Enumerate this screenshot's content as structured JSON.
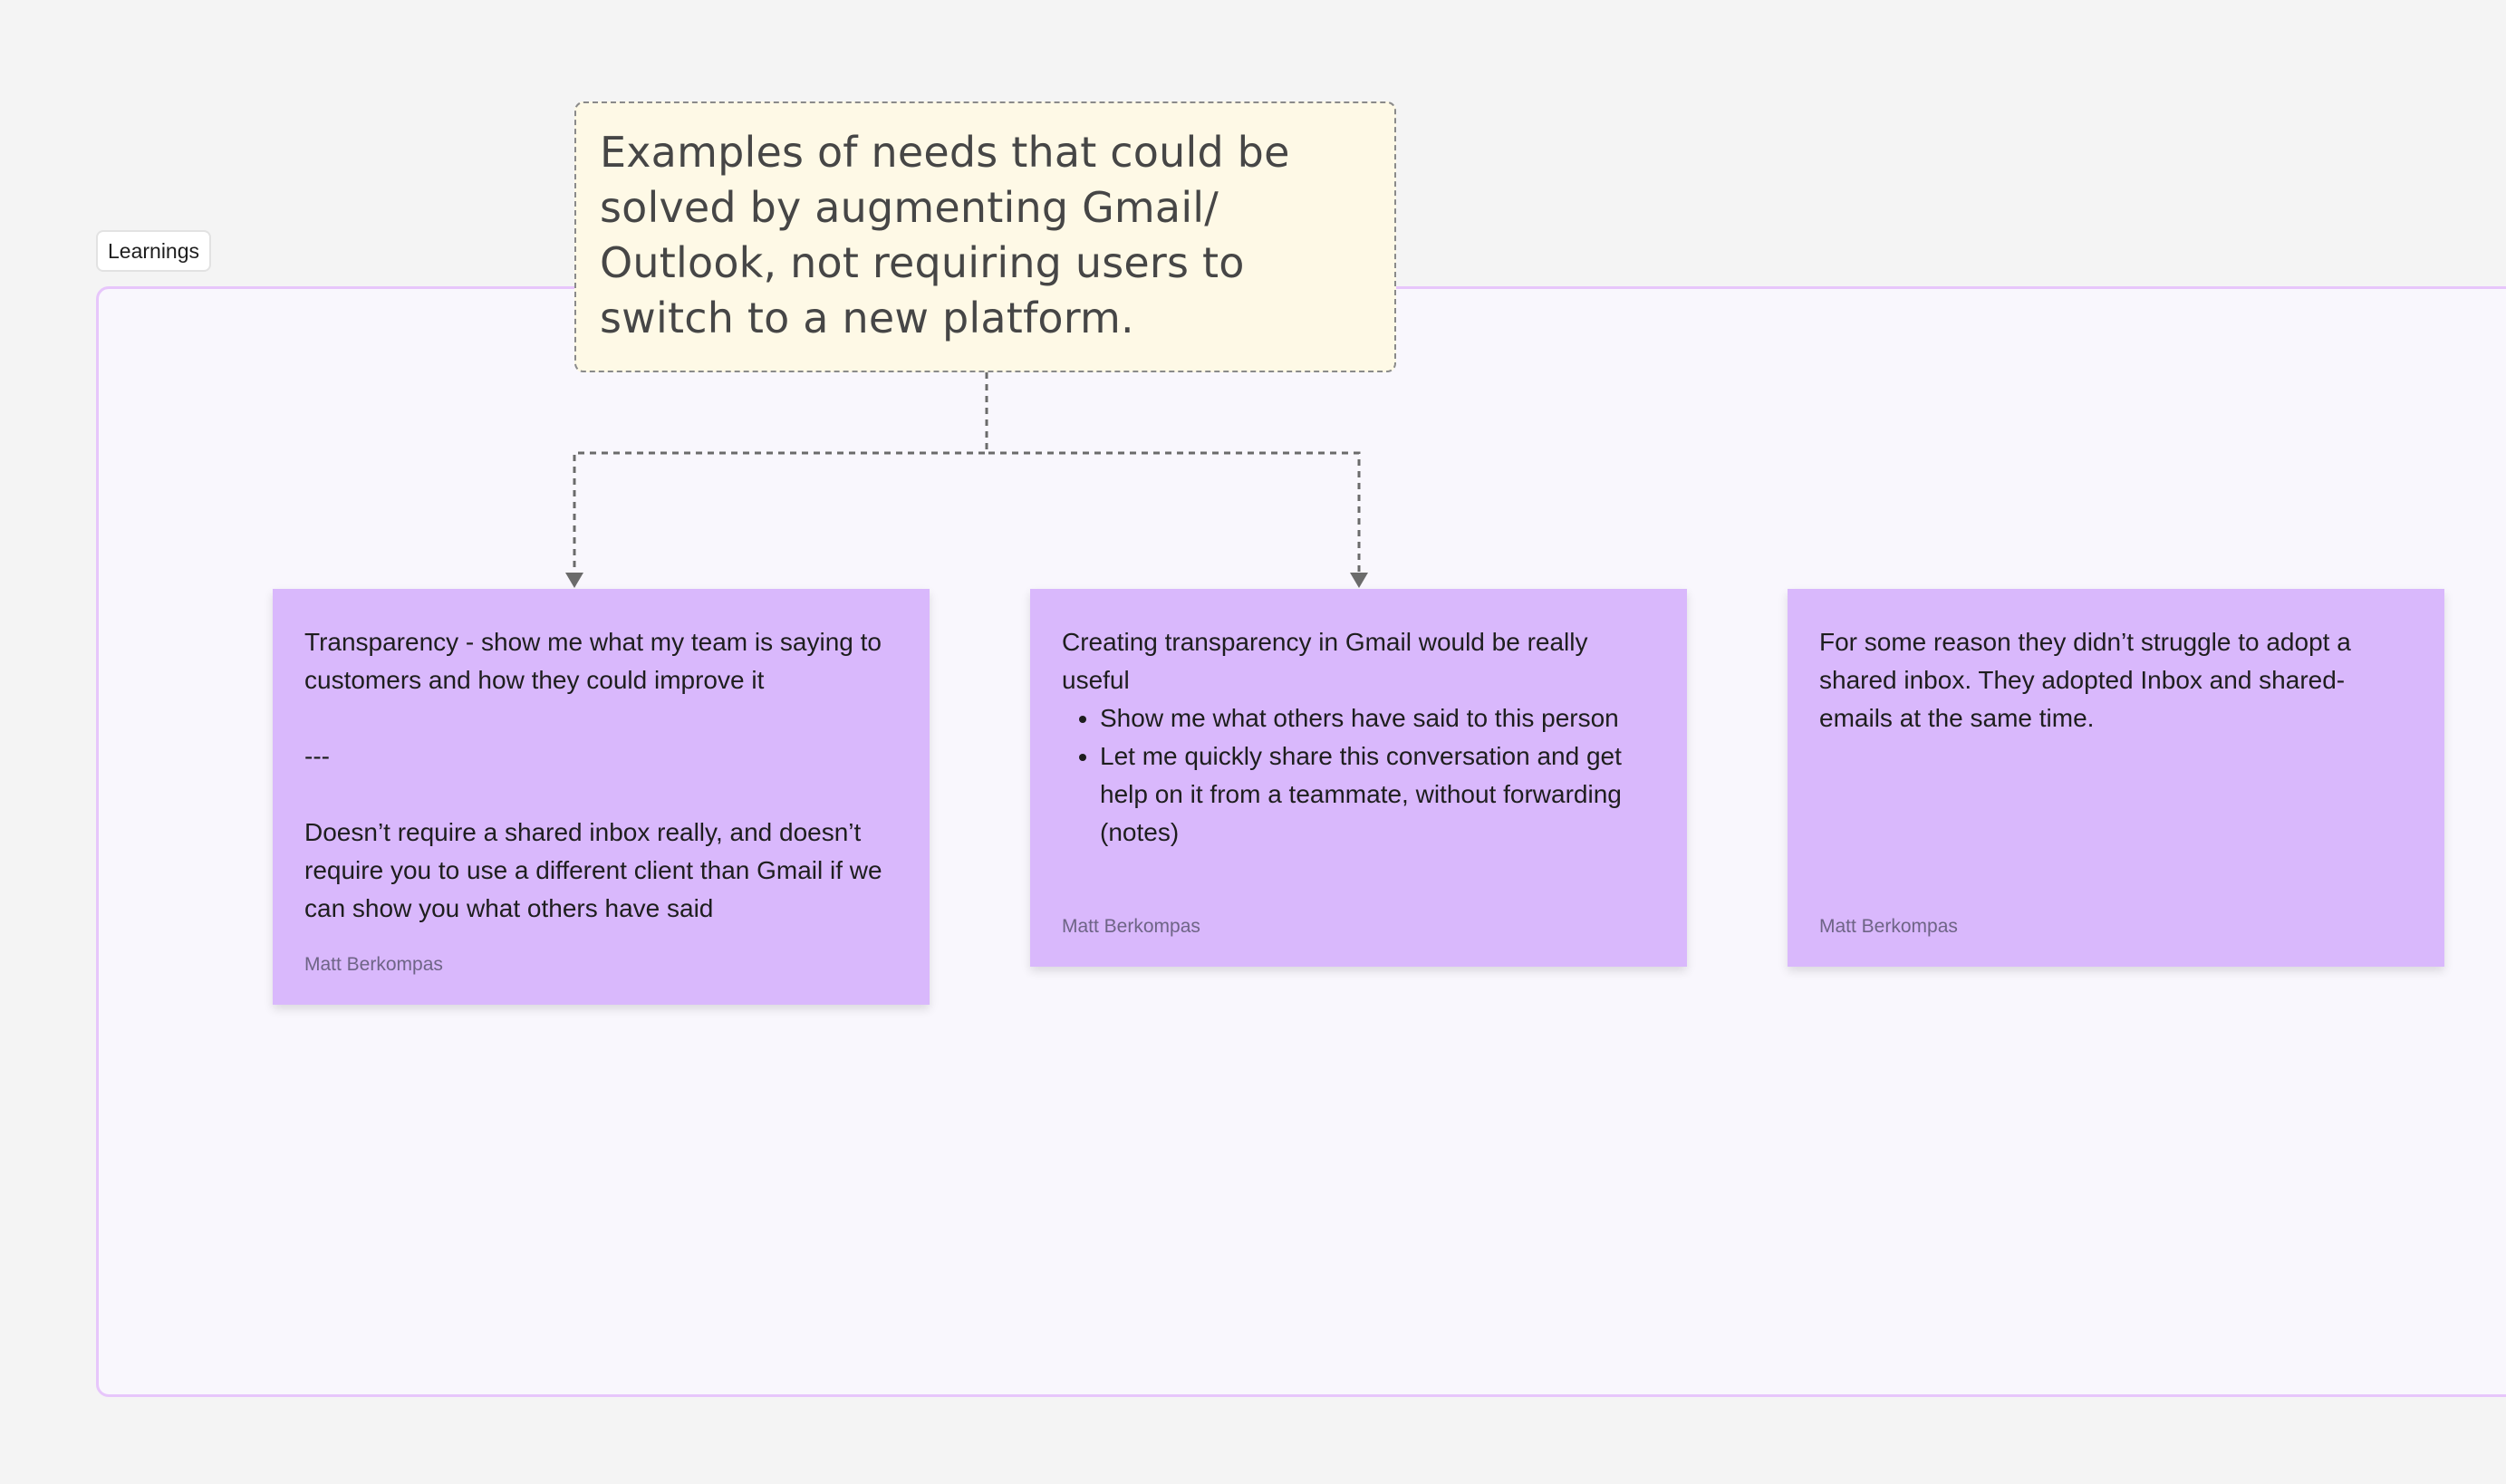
{
  "section": {
    "label": "Learnings"
  },
  "header_card": {
    "text": "Examples of needs that could be solved by augmenting Gmail/ Outlook, not requiring users to switch to a new platform."
  },
  "stickies": [
    {
      "lines": [
        "Transparency - show me what my team is saying to customers and how they could improve it",
        "---",
        "Doesn’t require a shared inbox really, and doesn’t require you to use a different client than Gmail if we can show you what others have said"
      ],
      "author": "Matt Berkompas"
    },
    {
      "intro": "Creating transparency in Gmail would be really useful",
      "bullets": [
        "Show me what others have said to this person",
        "Let me quickly share this conversation and get help on it from a teammate, without forwarding (notes)"
      ],
      "author": "Matt Berkompas"
    },
    {
      "text": "For some reason they didn’t struggle to adopt a shared inbox. They adopted Inbox and shared-emails at the same time.",
      "author": "Matt Berkompas"
    }
  ],
  "colors": {
    "sticky_purple": "#d9b8fc",
    "header_yellow": "#fef9e6",
    "section_border": "#e7c6fb",
    "connector": "#6b6b6b"
  }
}
